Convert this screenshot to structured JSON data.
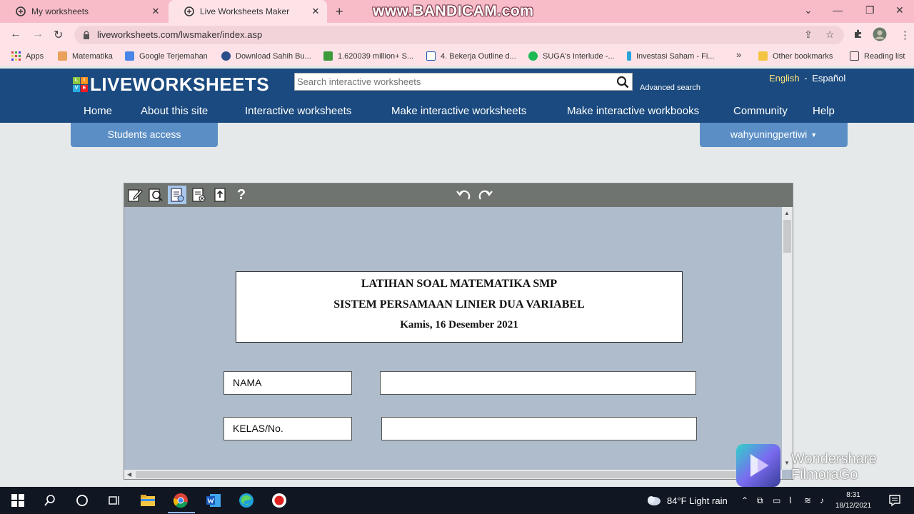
{
  "browser": {
    "tabs": [
      {
        "title": "My worksheets",
        "active": false
      },
      {
        "title": "Live Worksheets Maker",
        "active": true
      }
    ],
    "recording_watermark": "www.BANDICAM.com",
    "url": "liveworksheets.com/lwsmaker/index.asp",
    "bookmarks": [
      "Apps",
      "Matematika",
      "Google Terjemahan",
      "Download Sahih Bu...",
      "1.620039 million+ S...",
      "4. Bekerja Outline d...",
      "SUGA's Interlude -...",
      "Investasi Saham - Fi...",
      "Other bookmarks",
      "Reading list"
    ],
    "overflow_symbol": "»"
  },
  "site": {
    "logo_text": "LIVEWORKSHEETS",
    "logo_letters": [
      "L",
      "I",
      "V",
      "E"
    ],
    "search_placeholder": "Search interactive worksheets",
    "advanced_search": "Advanced search",
    "lang_english": "English",
    "lang_separator": "-",
    "lang_espanol": "Español",
    "nav": [
      "Home",
      "About this site",
      "Interactive worksheets",
      "Make interactive worksheets",
      "Make interactive workbooks",
      "Community",
      "Help"
    ],
    "students_access": "Students access",
    "username": "wahyuningpertiwi"
  },
  "editor": {
    "help_symbol": "?",
    "worksheet": {
      "title_line1": "LATIHAN SOAL MATEMATIKA SMP",
      "title_line2": "SISTEM PERSAMAAN LINIER DUA VARIABEL",
      "title_line3": "Kamis, 16 Desember 2021",
      "name_label": "NAMA",
      "class_label": "KELAS/No."
    }
  },
  "watermark": {
    "line1": "Wondershare",
    "line2": "FilmoraGo"
  },
  "taskbar": {
    "weather": "84°F  Light rain",
    "time": "8:31",
    "date": "18/12/2021"
  },
  "colors": {
    "tab_strip": "#f8bcc8",
    "site_header": "#1a4a7f",
    "button_blue": "#5b8ec5",
    "editor_bg": "#aebccb",
    "toolbar": "#707470"
  }
}
